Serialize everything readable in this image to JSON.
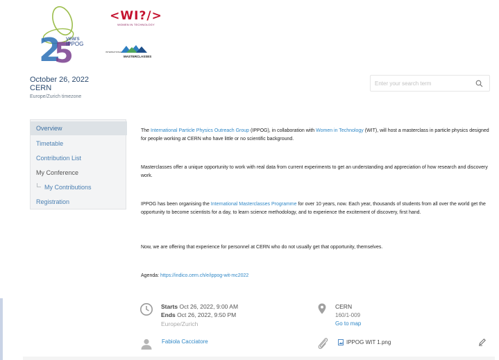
{
  "event": {
    "date": "October 26, 2022",
    "place": "CERN",
    "timezone": "Europe/Zurich timezone"
  },
  "logos": {
    "ippog_years": "years",
    "ippog_name": "IPPOG",
    "ippog_number": "25",
    "wit_text": "<WI?/>",
    "wit_sub": "WOMEN IN TECHNOLOGY",
    "imc_text": "MASTERCLASSES",
    "imc_small": "INTERNATIONAL"
  },
  "search": {
    "placeholder": "Enter your search term"
  },
  "menu": {
    "items": [
      {
        "label": "Overview"
      },
      {
        "label": "Timetable"
      },
      {
        "label": "Contribution List"
      },
      {
        "label": "My Conference"
      },
      {
        "label": "My Contributions"
      },
      {
        "label": "Registration"
      }
    ]
  },
  "content": {
    "p1_a": "The ",
    "p1_link1": "International Particle Physics Outreach Group",
    "p1_b": " (IPPOG), in collaboration with ",
    "p1_link2": "Women in Technology",
    "p1_c": " (WIT), will host a masterclass in particle physics designed for people working at CERN who have little or no scientific background.",
    "p2": "Masterclasses offer a unique opportunity to work with real data from current experiments to get an understanding and appreciation of how research and discovery work.",
    "p3_a": "IPPOG has been organising the ",
    "p3_link": "International Masterclasses Programme",
    "p3_b": " for over 10 years, now.  Each year, thousands of students from all over the world get the opportunity to become scientists for a day, to learn science methodology, and to experience the excitement of discovery, first hand.",
    "p4": "Now, we are offering that experience for personnel at CERN who do not usually get that opportunity, themselves.",
    "p5_a": "Agenda: ",
    "p5_link": "https://indico.cern.ch/e/ippog-wit-mc2022"
  },
  "details": {
    "starts_label": "Starts",
    "starts_value": " Oct 26, 2022, 9:00 AM",
    "ends_label": "Ends",
    "ends_value": " Oct 26, 2022, 9:50 PM",
    "timezone": "Europe/Zurich",
    "venue": "CERN",
    "room": "160/1-009",
    "map_link": "Go to map",
    "chairperson": "Fabiola Cacciatore",
    "attachment": "IPPOG WIT 1.png"
  },
  "colors": {
    "link": "#2f87c6",
    "menu_link": "#4a7fb2",
    "wit_red": "#c4122f"
  }
}
